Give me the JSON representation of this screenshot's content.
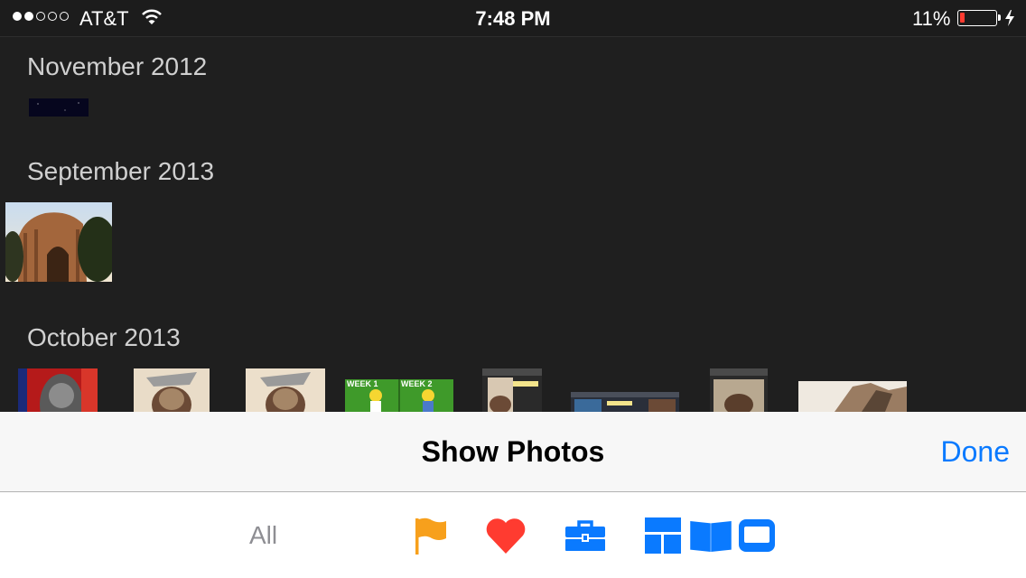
{
  "status_bar": {
    "signal": {
      "filled": 2,
      "total": 5
    },
    "carrier": "AT&T",
    "time": "7:48 PM",
    "battery_percent": "11%",
    "battery_level": 0.11,
    "charging": true
  },
  "sections": [
    {
      "title": "November 2012"
    },
    {
      "title": "September 2013"
    },
    {
      "title": "October 2013"
    }
  ],
  "october_thumbs": {
    "thumb_4_labels": [
      "WEEK 1",
      "WEEK 2"
    ]
  },
  "sheet": {
    "title": "Show Photos",
    "done_label": "Done"
  },
  "filters": {
    "all_label": "All",
    "icons": [
      "flag-icon",
      "heart-icon",
      "toolbox-icon",
      "mosaic-icon",
      "book-icon",
      "screen-icon"
    ]
  },
  "colors": {
    "accent": "#0a7aff",
    "flag": "#f7a01c",
    "heart": "#ff3b30",
    "background": "#1f1f1f"
  }
}
